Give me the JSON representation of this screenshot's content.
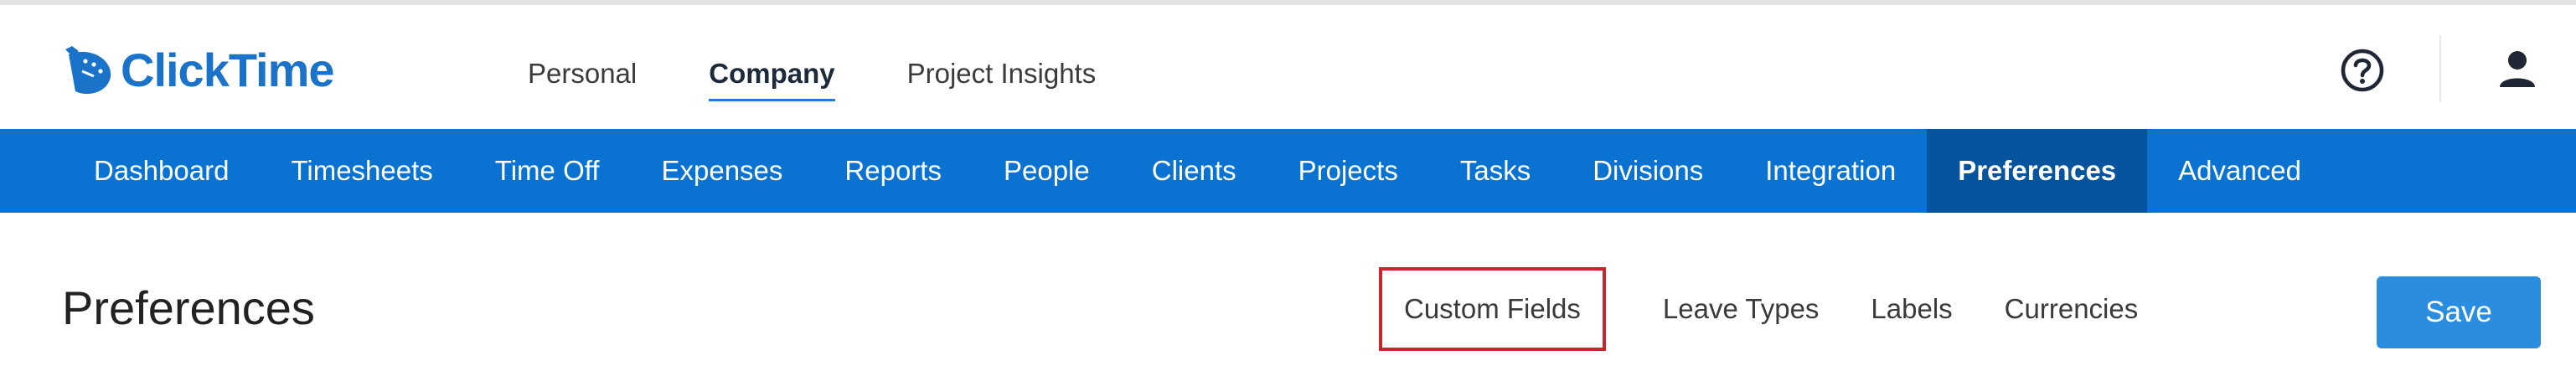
{
  "brand": {
    "name": "ClickTime",
    "color": "#1a73c8"
  },
  "top_nav": {
    "items": [
      {
        "label": "Personal",
        "active": false
      },
      {
        "label": "Company",
        "active": true
      },
      {
        "label": "Project Insights",
        "active": false
      }
    ]
  },
  "header_icons": {
    "help": "help-circle-icon",
    "user": "user-account-icon"
  },
  "main_nav": {
    "color": "#0a72d0",
    "active_color": "#07549e",
    "items": [
      {
        "label": "Dashboard",
        "active": false
      },
      {
        "label": "Timesheets",
        "active": false
      },
      {
        "label": "Time Off",
        "active": false
      },
      {
        "label": "Expenses",
        "active": false
      },
      {
        "label": "Reports",
        "active": false
      },
      {
        "label": "People",
        "active": false
      },
      {
        "label": "Clients",
        "active": false
      },
      {
        "label": "Projects",
        "active": false
      },
      {
        "label": "Tasks",
        "active": false
      },
      {
        "label": "Divisions",
        "active": false
      },
      {
        "label": "Integration",
        "active": false
      },
      {
        "label": "Preferences",
        "active": true
      },
      {
        "label": "Advanced",
        "active": false
      }
    ]
  },
  "page": {
    "title": "Preferences",
    "tabs": [
      {
        "label": "Custom Fields",
        "highlighted": true
      },
      {
        "label": "Leave Types",
        "highlighted": false
      },
      {
        "label": "Labels",
        "highlighted": false
      },
      {
        "label": "Currencies",
        "highlighted": false
      }
    ],
    "highlight_color": "#c6262e",
    "save_label": "Save",
    "save_color": "#2a8de0"
  }
}
